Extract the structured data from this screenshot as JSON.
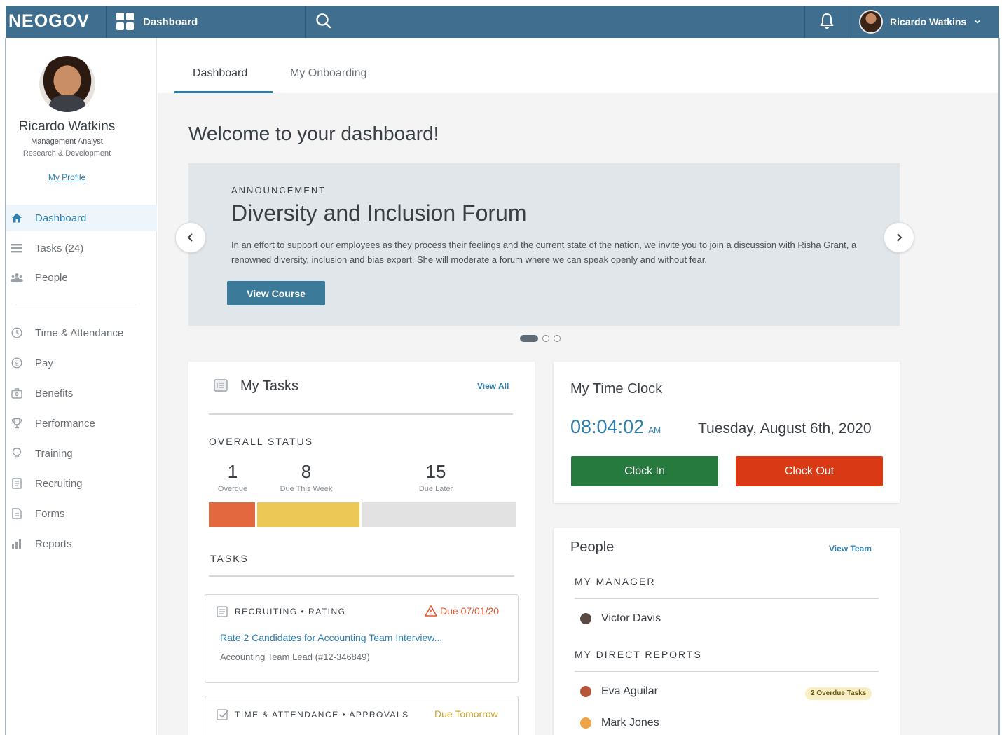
{
  "topbar": {
    "logo": "NEOGOV",
    "nav_label": "Dashboard",
    "user_name": "Ricardo Watkins"
  },
  "profile": {
    "name": "Ricardo Watkins",
    "title": "Management Analyst",
    "department": "Research & Development",
    "link": "My Profile"
  },
  "sidebar": {
    "primary": [
      {
        "label": "Dashboard",
        "icon": "home-icon"
      },
      {
        "label": "Tasks (24)",
        "icon": "list-icon"
      },
      {
        "label": "People",
        "icon": "people-icon"
      }
    ],
    "secondary": [
      {
        "label": "Time & Attendance",
        "icon": "clock-icon"
      },
      {
        "label": "Pay",
        "icon": "dollar-icon"
      },
      {
        "label": "Benefits",
        "icon": "briefcase-icon"
      },
      {
        "label": "Performance",
        "icon": "trophy-icon"
      },
      {
        "label": "Training",
        "icon": "lightbulb-icon"
      },
      {
        "label": "Recruiting",
        "icon": "document-icon"
      },
      {
        "label": "Forms",
        "icon": "form-icon"
      },
      {
        "label": "Reports",
        "icon": "bar-chart-icon"
      }
    ]
  },
  "tabs": [
    "Dashboard",
    "My Onboarding"
  ],
  "welcome": "Welcome to your dashboard!",
  "announcement": {
    "label": "ANNOUNCEMENT",
    "title": "Diversity and Inclusion Forum",
    "body": "In an effort to support our employees as they process their feelings and the current state of the nation, we invite you to join a discussion with Risha Grant, a renowned diversity, inclusion and bias expert. She will moderate a forum where we can speak openly and without fear.",
    "button": "View Course",
    "slides": 3,
    "active_slide": 1
  },
  "tasks_card": {
    "title": "My Tasks",
    "view_all": "View All",
    "overall_status_label": "OVERALL STATUS",
    "stats": [
      {
        "value": "1",
        "label": "Overdue",
        "color": "#e3673f"
      },
      {
        "value": "8",
        "label": "Due This Week",
        "color": "#ecc857"
      },
      {
        "value": "15",
        "label": "Due Later",
        "color": "#e2e2e2"
      }
    ],
    "tasks_label": "TASKS",
    "tasks": [
      {
        "category": "RECRUITING • RATING",
        "due": "Due 07/01/20",
        "due_color": "#e0542c",
        "title": "Rate 2 Candidates for Accounting Team Interview...",
        "subtitle": "Accounting Team Lead (#12-346849)"
      },
      {
        "category": "TIME & ATTENDANCE • APPROVALS",
        "due": "Due Tomorrow",
        "due_color": "#c9a22a"
      }
    ]
  },
  "time_clock": {
    "title": "My Time Clock",
    "time": "08:04:02",
    "ampm": "AM",
    "date": "Tuesday, August 6th, 2020",
    "clock_in": "Clock In",
    "clock_out": "Clock Out",
    "clock_in_color": "#267a3e",
    "clock_out_color": "#d93a15"
  },
  "people_card": {
    "title": "People",
    "view_team": "View Team",
    "manager_label": "MY MANAGER",
    "manager": "Victor Davis",
    "reports_label": "MY DIRECT REPORTS",
    "reports": [
      {
        "name": "Eva Aguilar",
        "badge": "2 Overdue Tasks"
      },
      {
        "name": "Mark Jones",
        "badge": ""
      }
    ]
  },
  "colors": {
    "topbar": "#3f6e8f",
    "accent": "#2f7fb0",
    "button": "#3c7a9a"
  }
}
